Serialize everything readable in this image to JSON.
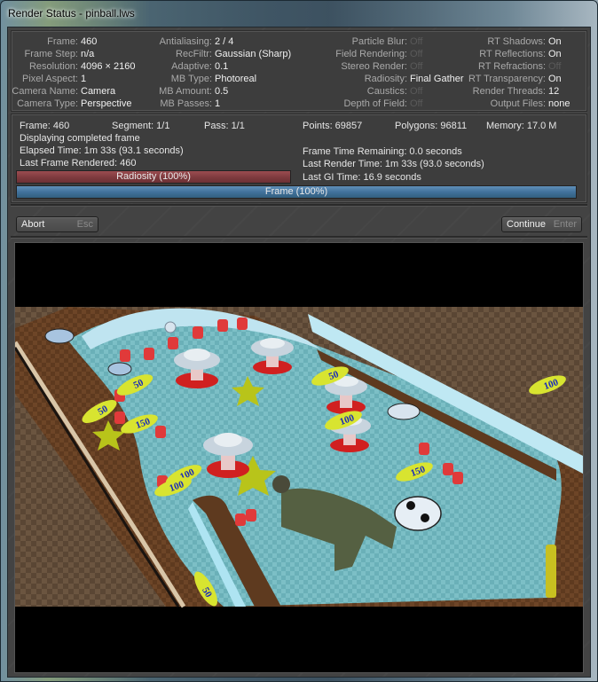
{
  "window": {
    "title": "Render Status - pinball.lws"
  },
  "info": {
    "col1": [
      {
        "label": "Frame:",
        "value": "460"
      },
      {
        "label": "Frame Step:",
        "value": "n/a"
      },
      {
        "label": "Resolution:",
        "value": "4096 × 2160"
      },
      {
        "label": "Pixel Aspect:",
        "value": "1"
      },
      {
        "label": "Camera Name:",
        "value": "Camera"
      },
      {
        "label": "Camera Type:",
        "value": "Perspective"
      }
    ],
    "col2": [
      {
        "label": "Antialiasing:",
        "value": "2 / 4"
      },
      {
        "label": "RecFiltr:",
        "value": "Gaussian (Sharp)"
      },
      {
        "label": "Adaptive:",
        "value": "0.1"
      },
      {
        "label": "MB Type:",
        "value": "Photoreal"
      },
      {
        "label": "MB Amount:",
        "value": "0.5"
      },
      {
        "label": "MB Passes:",
        "value": "1"
      }
    ],
    "col3": [
      {
        "label": "Particle Blur:",
        "value": "Off"
      },
      {
        "label": "Field Rendering:",
        "value": "Off"
      },
      {
        "label": "Stereo Render:",
        "value": "Off"
      },
      {
        "label": "Radiosity:",
        "value": "Final Gather"
      },
      {
        "label": "Caustics:",
        "value": "Off"
      },
      {
        "label": "Depth of Field:",
        "value": "Off"
      }
    ],
    "col4": [
      {
        "label": "RT Shadows:",
        "value": "On"
      },
      {
        "label": "RT Reflections:",
        "value": "On"
      },
      {
        "label": "RT Refractions:",
        "value": "Off"
      },
      {
        "label": "RT Transparency:",
        "value": "On"
      },
      {
        "label": "Render Threads:",
        "value": "12"
      },
      {
        "label": "Output Files:",
        "value": "none"
      }
    ]
  },
  "status": {
    "frame": "Frame: 460",
    "segment": "Segment: 1/1",
    "pass": "Pass: 1/1",
    "points": "Points: 69857",
    "polygons": "Polygons: 96811",
    "memory": "Memory: 17.0 M",
    "message": "Displaying completed frame",
    "elapsed": "Elapsed Time: 1m 33s (93.1 seconds)",
    "last_frame": "Last Frame Rendered: 460",
    "remaining": "Frame Time Remaining: 0.0 seconds",
    "last_render": "Last Render Time: 1m 33s (93.0 seconds)",
    "last_gi": "Last GI Time: 16.9 seconds"
  },
  "progress": {
    "radiosity": {
      "label": "Radiosity (100%)",
      "percent": 100,
      "color": "#7e3a3e"
    },
    "frame": {
      "label": "Frame (100%)",
      "percent": 100,
      "color": "#3f6f99"
    }
  },
  "buttons": {
    "abort": {
      "label": "Abort",
      "shortcut": "Esc"
    },
    "continue": {
      "label": "Continue",
      "shortcut": "Enter"
    }
  },
  "preview": {
    "description": "Rendered pinball table scene",
    "score_labels": [
      "50",
      "50",
      "150",
      "100",
      "100",
      "100",
      "150",
      "50",
      "100",
      "50"
    ]
  }
}
